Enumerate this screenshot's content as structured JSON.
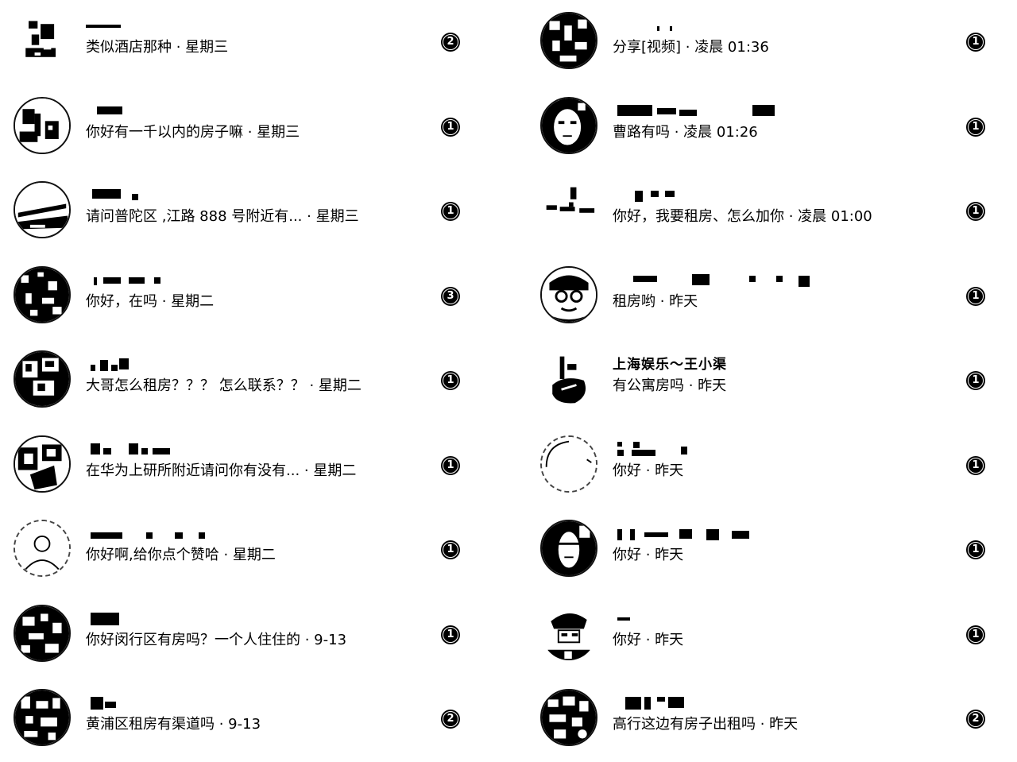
{
  "left_column": [
    {
      "preview": "类似酒店那种 · 星期三",
      "badge": "2"
    },
    {
      "preview": "你好有一千以内的房子嘛 · 星期三",
      "badge": "1"
    },
    {
      "preview": "请问普陀区 ,江路 888 号附近有...  · 星期三",
      "badge": "1"
    },
    {
      "preview": "你好，在吗 · 星期二",
      "badge": "3"
    },
    {
      "preview": "大哥怎么租房？？？ 怎么联系？？ · 星期二",
      "badge": "1"
    },
    {
      "preview": "在华为上研所附近请问你有没有...  · 星期二",
      "badge": "1"
    },
    {
      "preview": "你好啊,给你点个赞哈      · 星期二",
      "badge": "1"
    },
    {
      "preview": "你好闵行区有房吗？一个人住住的 · 9-13",
      "badge": "1"
    },
    {
      "preview": "黄浦区租房有渠道吗 · 9-13",
      "badge": "2"
    }
  ],
  "right_column": [
    {
      "preview": "分享[视频] · 凌晨 01:36",
      "badge": "1"
    },
    {
      "preview": "曹路有吗 · 凌晨 01:26",
      "badge": "1"
    },
    {
      "preview": "你好，我要租房、怎么加你 · 凌晨 01:00",
      "badge": "1"
    },
    {
      "preview": "租房哟 · 昨天",
      "badge": "1"
    },
    {
      "name": "上海娱乐～王小渠",
      "preview": "有公寓房吗 · 昨天",
      "badge": "1"
    },
    {
      "preview": "你好 · 昨天",
      "badge": "1"
    },
    {
      "preview": "你好 · 昨天",
      "badge": "1"
    },
    {
      "preview": "你好 · 昨天",
      "badge": "1"
    },
    {
      "preview": "高行这边有房子出租吗 · 昨天",
      "badge": "2"
    }
  ]
}
